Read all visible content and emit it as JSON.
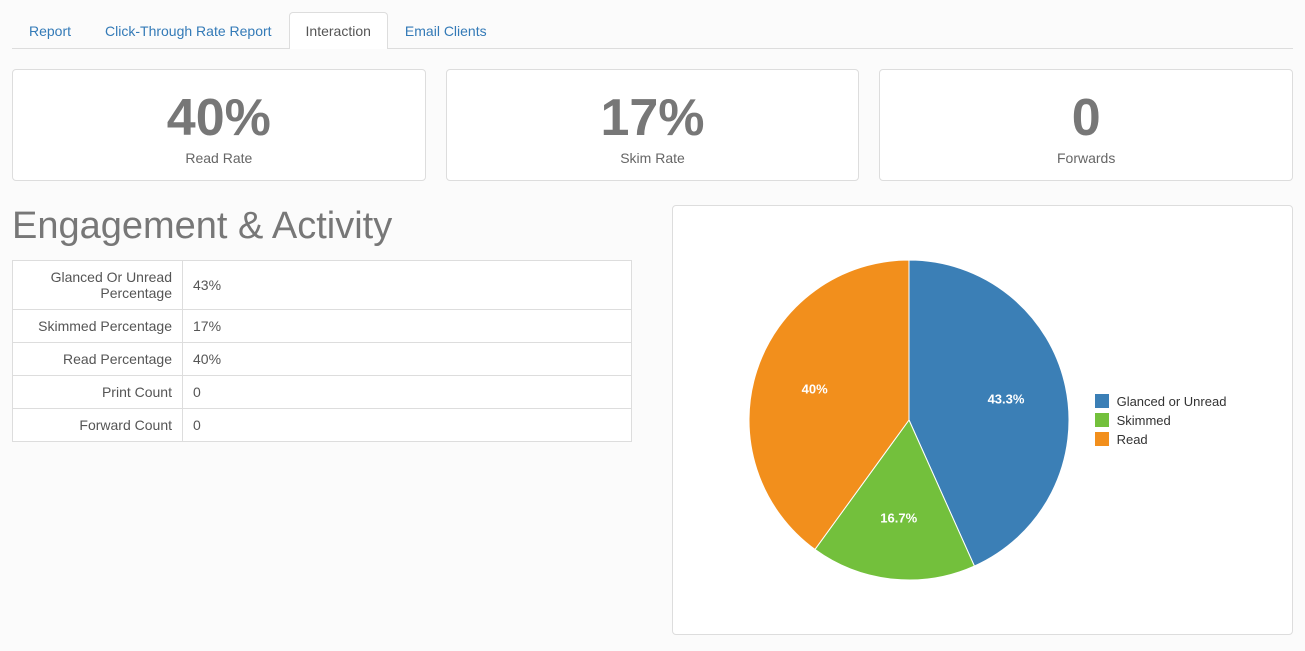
{
  "tabs": [
    {
      "label": "Report",
      "active": false
    },
    {
      "label": "Click-Through Rate Report",
      "active": false
    },
    {
      "label": "Interaction",
      "active": true
    },
    {
      "label": "Email Clients",
      "active": false
    }
  ],
  "stats": {
    "read_rate": {
      "value": "40%",
      "label": "Read Rate"
    },
    "skim_rate": {
      "value": "17%",
      "label": "Skim Rate"
    },
    "forwards": {
      "value": "0",
      "label": "Forwards"
    }
  },
  "section_title": "Engagement & Activity",
  "engagement_rows": [
    {
      "label": "Glanced Or Unread Percentage",
      "value": "43%"
    },
    {
      "label": "Skimmed Percentage",
      "value": "17%"
    },
    {
      "label": "Read Percentage",
      "value": "40%"
    },
    {
      "label": "Print Count",
      "value": "0"
    },
    {
      "label": "Forward Count",
      "value": "0"
    }
  ],
  "legend": {
    "glanced": "Glanced or Unread",
    "skimmed": "Skimmed",
    "read": "Read"
  },
  "colors": {
    "glanced": "#3b7fb6",
    "skimmed": "#73c03c",
    "read": "#f28f1c"
  },
  "chart_data": {
    "type": "pie",
    "title": "",
    "series": [
      {
        "name": "Glanced or Unread",
        "value": 43.3,
        "label": "43.3%",
        "color": "#3b7fb6"
      },
      {
        "name": "Skimmed",
        "value": 16.7,
        "label": "16.7%",
        "color": "#73c03c"
      },
      {
        "name": "Read",
        "value": 40.0,
        "label": "40%",
        "color": "#f28f1c"
      }
    ]
  }
}
